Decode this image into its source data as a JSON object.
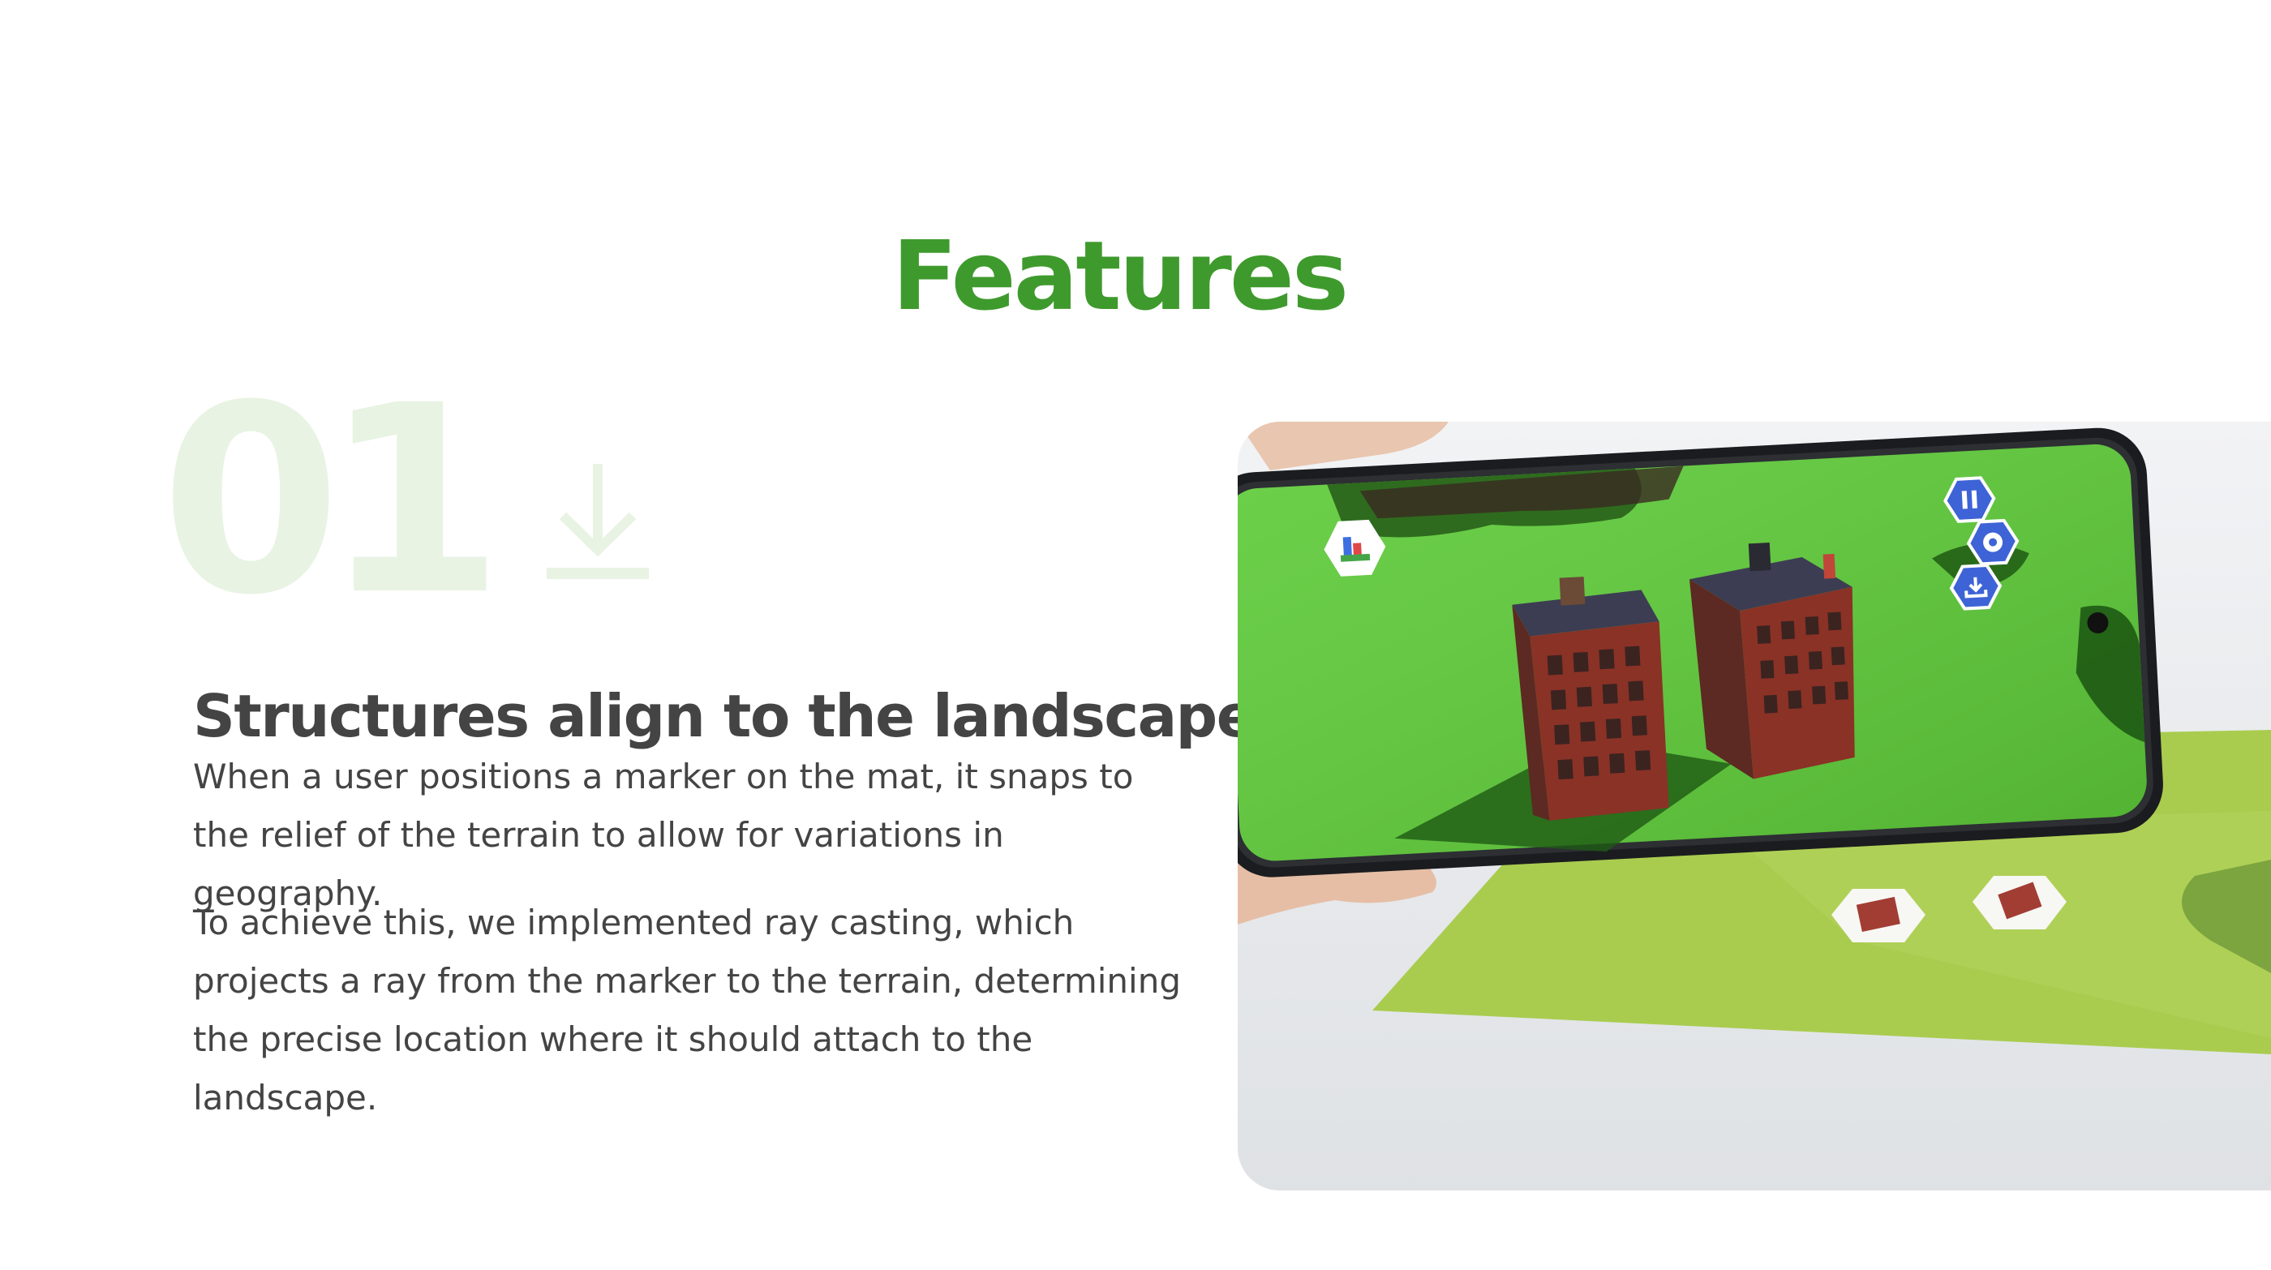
{
  "page": {
    "title": "Features"
  },
  "feature": {
    "number": "01",
    "icon": "download-icon",
    "heading": "Structures align to the landscape",
    "paragraphs": [
      "When a user positions a marker on the mat, it snaps to the relief of the terrain to allow for variations in geography.",
      "To achieve this, we implemented ray casting, which projects a ray from the marker to the terrain, determining the precise location where it should attach to the landscape."
    ]
  },
  "photo": {
    "subject": "phone-ar-app-screenshot",
    "app_buttons": [
      "pause-icon",
      "gear-icon",
      "download-icon"
    ]
  },
  "colors": {
    "accent_green": "#3f9a2d",
    "faint_green": "#e8f3e3",
    "body_text": "#444444",
    "app_button_blue": "#3e63d6"
  }
}
